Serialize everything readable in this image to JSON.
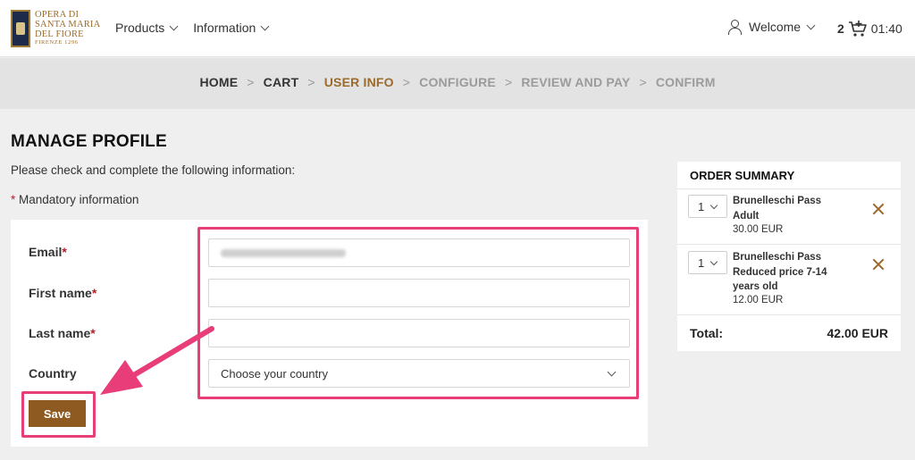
{
  "header": {
    "logo_lines": [
      "OPERA DI",
      "SANTA MARIA",
      "DEL FIORE"
    ],
    "logo_sub": "FIRENZE 1296",
    "nav": [
      {
        "label": "Products",
        "icon": "chevron-down-icon"
      },
      {
        "label": "Information",
        "icon": "chevron-down-icon"
      }
    ],
    "welcome_label": "Welcome",
    "cart_count": "2",
    "timer": "01:40"
  },
  "steps": [
    {
      "label": "HOME",
      "state": "done"
    },
    {
      "label": "CART",
      "state": "done"
    },
    {
      "label": "USER INFO",
      "state": "active"
    },
    {
      "label": "CONFIGURE",
      "state": "todo"
    },
    {
      "label": "REVIEW AND PAY",
      "state": "todo"
    },
    {
      "label": "CONFIRM",
      "state": "todo"
    }
  ],
  "step_separator": ">",
  "page": {
    "title": "MANAGE PROFILE",
    "intro": "Please check and complete the following information:",
    "mandatory_mark": "*",
    "mandatory_note": "Mandatory information"
  },
  "form": {
    "email_label": "Email",
    "first_name_label": "First name",
    "last_name_label": "Last name",
    "country_label": "Country",
    "required_mark": "*",
    "email_value": "",
    "first_name_value": "",
    "last_name_value": "",
    "country_placeholder": "Choose your country",
    "save_label": "Save"
  },
  "summary": {
    "title": "ORDER SUMMARY",
    "items": [
      {
        "qty": "1",
        "name": "Brunelleschi Pass Adult",
        "price": "30.00 EUR"
      },
      {
        "qty": "1",
        "name": "Brunelleschi Pass Reduced price 7-14 years old",
        "price": "12.00 EUR"
      }
    ],
    "total_label": "Total:",
    "total_value": "42.00 EUR"
  },
  "colors": {
    "accent": "#9a6b2c",
    "button": "#8f5a22",
    "annotation": "#e83d78",
    "required": "#b3202a"
  }
}
